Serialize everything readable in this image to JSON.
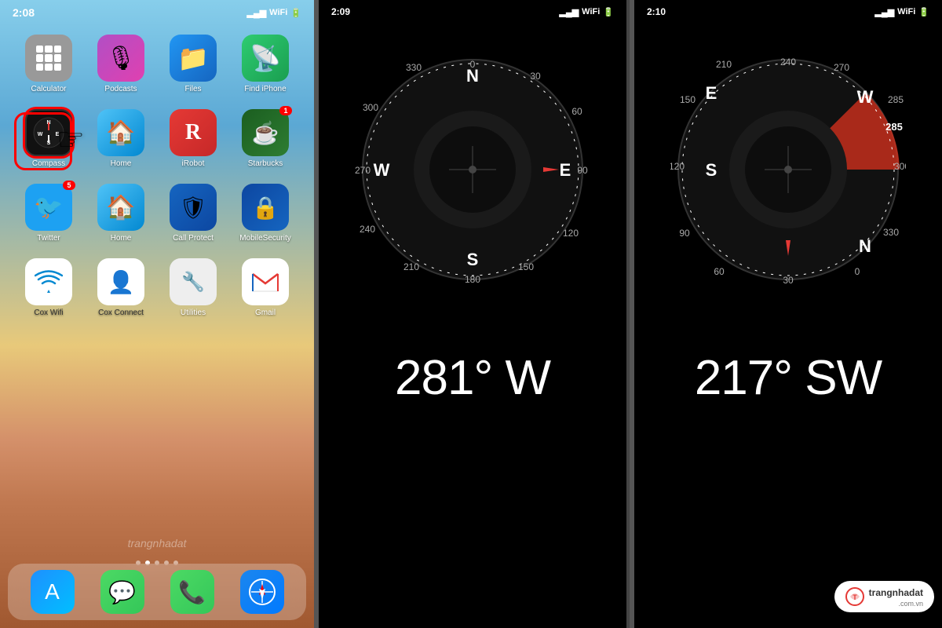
{
  "phone1": {
    "status_time": "2:08",
    "apps": [
      {
        "id": "calculator",
        "label": "Calculator",
        "icon_class": "icon-calculator",
        "emoji": "🧮",
        "badge": null
      },
      {
        "id": "podcasts",
        "label": "Podcasts",
        "icon_class": "icon-podcasts",
        "emoji": "🎙",
        "badge": null
      },
      {
        "id": "files",
        "label": "Files",
        "icon_class": "icon-files",
        "emoji": "📁",
        "badge": null
      },
      {
        "id": "findiphone",
        "label": "Find iPhone",
        "icon_class": "icon-findphone",
        "emoji": "📡",
        "badge": null
      },
      {
        "id": "compass",
        "label": "Compass",
        "icon_class": "icon-compass",
        "emoji": "🧭",
        "badge": null
      },
      {
        "id": "home",
        "label": "Home",
        "icon_class": "icon-home",
        "emoji": "🏠",
        "badge": null
      },
      {
        "id": "irobot",
        "label": "iRobot",
        "icon_class": "icon-irobot",
        "emoji": "R",
        "badge": null
      },
      {
        "id": "starbucks",
        "label": "Starbucks",
        "icon_class": "icon-starbucks",
        "emoji": "☕",
        "badge": "1"
      },
      {
        "id": "twitter",
        "label": "Twitter",
        "icon_class": "icon-twitter",
        "emoji": "🐦",
        "badge": "5"
      },
      {
        "id": "coxhome",
        "label": "Home",
        "icon_class": "icon-home",
        "emoji": "🏠",
        "badge": null
      },
      {
        "id": "callprotect",
        "label": "Call Protect",
        "icon_class": "icon-callprotect",
        "emoji": "🛡",
        "badge": null
      },
      {
        "id": "mobilesec",
        "label": "MobileSecurity",
        "icon_class": "icon-mobilesec",
        "emoji": "🔒",
        "badge": null
      },
      {
        "id": "coxwifi",
        "label": "Cox Wifi",
        "icon_class": "icon-coxwifi",
        "emoji": "📶",
        "badge": null
      },
      {
        "id": "coxconnect",
        "label": "Cox Connect",
        "icon_class": "icon-coxconnect",
        "emoji": "👤",
        "badge": null
      },
      {
        "id": "utilities",
        "label": "Utilities",
        "icon_class": "icon-utilities",
        "emoji": "🔧",
        "badge": null
      },
      {
        "id": "gmail",
        "label": "Gmail",
        "icon_class": "icon-gmail",
        "emoji": "✉",
        "badge": null
      }
    ],
    "dock": [
      {
        "id": "appstore",
        "label": "",
        "emoji": "🅰",
        "color": "#1c86ee"
      },
      {
        "id": "messages",
        "label": "",
        "emoji": "💬",
        "color": "#4cd964"
      },
      {
        "id": "phone",
        "label": "",
        "emoji": "📞",
        "color": "#4cd964"
      },
      {
        "id": "safari",
        "label": "",
        "emoji": "🧭",
        "color": "#1c86ee"
      }
    ],
    "watermark": "trangnhadat"
  },
  "phone2": {
    "status_time": "2:09",
    "compass_reading": "281° W",
    "compass_direction": "W",
    "compass_degrees": 281,
    "red_needle_angle": 0
  },
  "phone3": {
    "status_time": "2:10",
    "compass_reading": "217° SW",
    "compass_direction": "SW",
    "compass_degrees": 217,
    "red_zone": true,
    "current_label": "W",
    "current_value": "285"
  },
  "divider_color": "#555",
  "logo": {
    "text": "trangnhadat",
    "domain": ".com.vn"
  }
}
